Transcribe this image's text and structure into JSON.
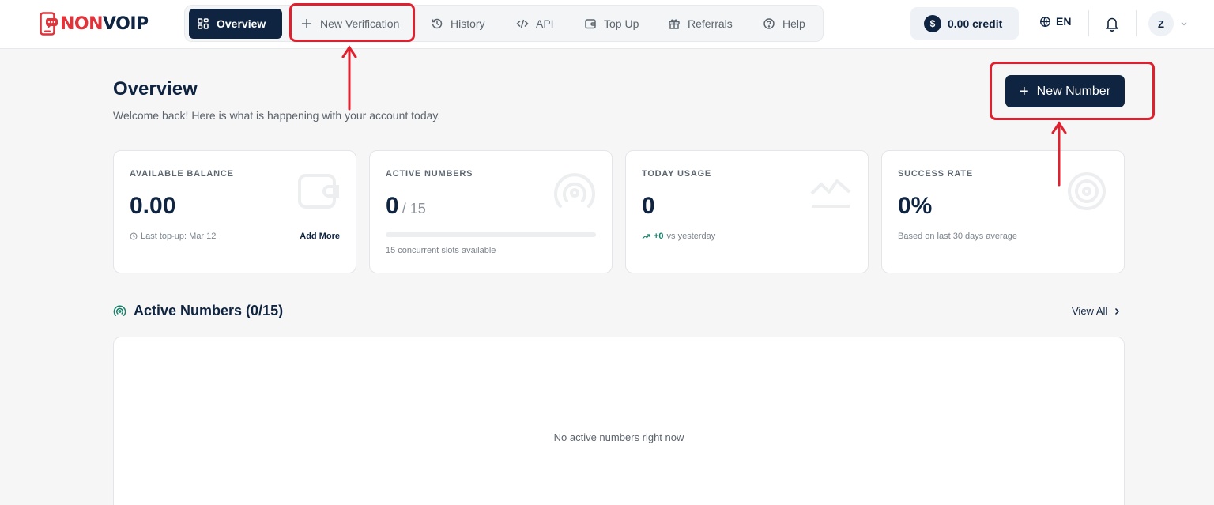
{
  "brand": {
    "part1": "NON",
    "part2": "VOIP"
  },
  "nav": {
    "items": [
      {
        "label": "Overview",
        "icon": "grid-icon",
        "active": true
      },
      {
        "label": "New Verification",
        "icon": "plus-icon"
      },
      {
        "label": "History",
        "icon": "history-icon"
      },
      {
        "label": "API",
        "icon": "code-icon"
      },
      {
        "label": "Top Up",
        "icon": "wallet-icon"
      },
      {
        "label": "Referrals",
        "icon": "gift-icon"
      },
      {
        "label": "Help",
        "icon": "help-circle-icon"
      }
    ]
  },
  "header": {
    "credit_symbol": "$",
    "credit_label": "0.00 credit",
    "language": "EN",
    "avatar_initial": "Z"
  },
  "page": {
    "title": "Overview",
    "subtitle": "Welcome back! Here is what is happening with your account today.",
    "new_number_label": "New Number",
    "new_number_icon": "+"
  },
  "cards": {
    "balance": {
      "label": "AVAILABLE BALANCE",
      "value": "0.00",
      "foot": "Last top-up: Mar 12",
      "link": "Add More",
      "icon": "wallet-icon"
    },
    "active": {
      "label": "ACTIVE NUMBERS",
      "value": "0",
      "of": "/ 15",
      "foot": "15 concurrent slots available",
      "icon": "signal-icon",
      "progress_fraction": 0
    },
    "usage": {
      "label": "TODAY USAGE",
      "value": "0",
      "delta": "+0",
      "delta_text": "vs yesterday",
      "icon": "trend-chart-icon"
    },
    "success": {
      "label": "SUCCESS RATE",
      "value": "0%",
      "foot": "Based on last 30 days average",
      "icon": "target-icon"
    }
  },
  "section": {
    "title": "Active Numbers (0/15)",
    "view_all": "View All",
    "empty": "No active numbers right now"
  },
  "colors": {
    "navy": "#0f2440",
    "brand_red": "#e0333a",
    "annotation_red": "#e0202e",
    "positive_green": "#16806a"
  }
}
